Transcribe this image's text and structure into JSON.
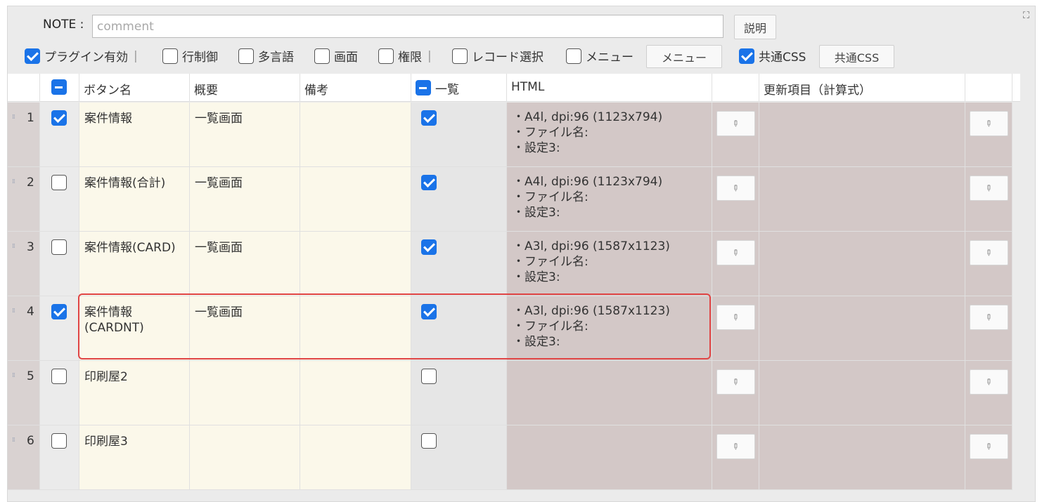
{
  "note": {
    "label": "NOTE :",
    "placeholder": "comment",
    "explain_button": "説明"
  },
  "options": {
    "plugin_enabled": {
      "label": "プラグイン有効",
      "checked": true
    },
    "row_control": {
      "label": "行制御",
      "checked": false
    },
    "multilang": {
      "label": "多言語",
      "checked": false
    },
    "screen": {
      "label": "画面",
      "checked": false
    },
    "permission": {
      "label": "権限",
      "checked": false
    },
    "record_select": {
      "label": "レコード選択",
      "checked": false
    },
    "menu": {
      "label": "メニュー",
      "checked": false
    },
    "menu_button": "メニュー",
    "common_css": {
      "label": "共通CSS",
      "checked": true
    },
    "common_css_button": "共通CSS",
    "separator": "|"
  },
  "table": {
    "headers": {
      "button_name": "ボタン名",
      "summary": "概要",
      "remarks": "備考",
      "list": "一覧",
      "html": "HTML",
      "update_items": "更新項目（計算式）"
    },
    "rows": [
      {
        "num": "1",
        "checked": true,
        "name": "案件情報",
        "summary": "一覧画面",
        "remarks": "",
        "list": true,
        "html": [
          "・A4l, dpi:96 (1123x794)",
          "・ファイル名:",
          "・設定3:"
        ]
      },
      {
        "num": "2",
        "checked": false,
        "name": "案件情報(合計)",
        "summary": "一覧画面",
        "remarks": "",
        "list": true,
        "html": [
          "・A4l, dpi:96 (1123x794)",
          "・ファイル名:",
          "・設定3:"
        ]
      },
      {
        "num": "3",
        "checked": false,
        "name": "案件情報(CARD)",
        "summary": "一覧画面",
        "remarks": "",
        "list": true,
        "html": [
          "・A3l, dpi:96 (1587x1123)",
          "・ファイル名:",
          "・設定3:"
        ]
      },
      {
        "num": "4",
        "checked": true,
        "name": "案件情報\n(CARDNT)",
        "summary": "一覧画面",
        "remarks": "",
        "list": true,
        "html": [
          "・A3l, dpi:96 (1587x1123)",
          "・ファイル名:",
          "・設定3:"
        ]
      },
      {
        "num": "5",
        "checked": false,
        "name": "印刷屋2",
        "summary": "",
        "remarks": "",
        "list": false,
        "html": []
      },
      {
        "num": "6",
        "checked": false,
        "name": "印刷屋3",
        "summary": "",
        "remarks": "",
        "list": false,
        "html": []
      }
    ]
  }
}
